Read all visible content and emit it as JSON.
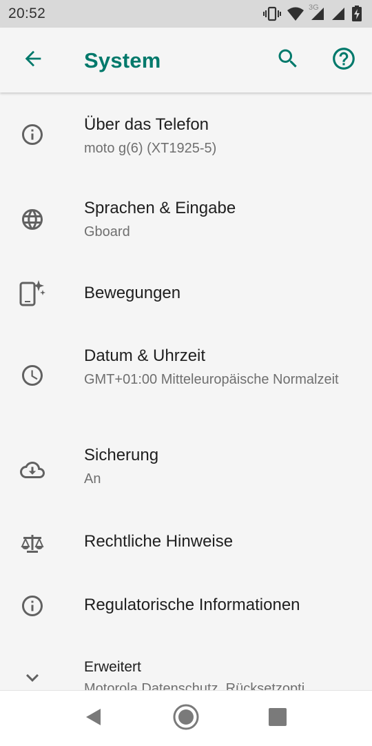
{
  "status_bar": {
    "time": "20:52",
    "network_type": "3G",
    "icons": [
      "vibrate-icon",
      "wifi-icon",
      "cell-signal-icon",
      "cell-signal-icon",
      "battery-charging-icon"
    ]
  },
  "app_bar": {
    "title": "System",
    "back_icon": "arrow-back-icon",
    "search_icon": "search-icon",
    "help_icon": "help-icon"
  },
  "settings": [
    {
      "title": "Über das Telefon",
      "subtitle": "moto g(6) (XT1925-5)",
      "icon": "info-icon"
    },
    {
      "title": "Sprachen & Eingabe",
      "subtitle": "Gboard",
      "icon": "globe-icon"
    },
    {
      "title": "Bewegungen",
      "subtitle": "",
      "icon": "phone-gestures-icon"
    },
    {
      "title": "Datum & Uhrzeit",
      "subtitle": "GMT+01:00 Mitteleuropäische Normalzeit",
      "icon": "clock-icon"
    },
    {
      "title": "Sicherung",
      "subtitle": "An",
      "icon": "cloud-backup-icon"
    },
    {
      "title": "Rechtliche Hinweise",
      "subtitle": "",
      "icon": "scale-icon"
    },
    {
      "title": "Regulatorische Informationen",
      "subtitle": "",
      "icon": "info-icon"
    },
    {
      "title": "Erweitert",
      "subtitle": "Motorola Datenschutz, Rücksetzopti",
      "icon": "chevron-down-icon"
    }
  ],
  "nav_bar": {
    "icons": [
      "nav-back-icon",
      "nav-home-icon",
      "nav-recents-icon"
    ]
  },
  "colors": {
    "accent": "#00796b",
    "background": "#f5f5f5",
    "status_bar": "#d9d9d9",
    "icon_gray": "#616161"
  }
}
